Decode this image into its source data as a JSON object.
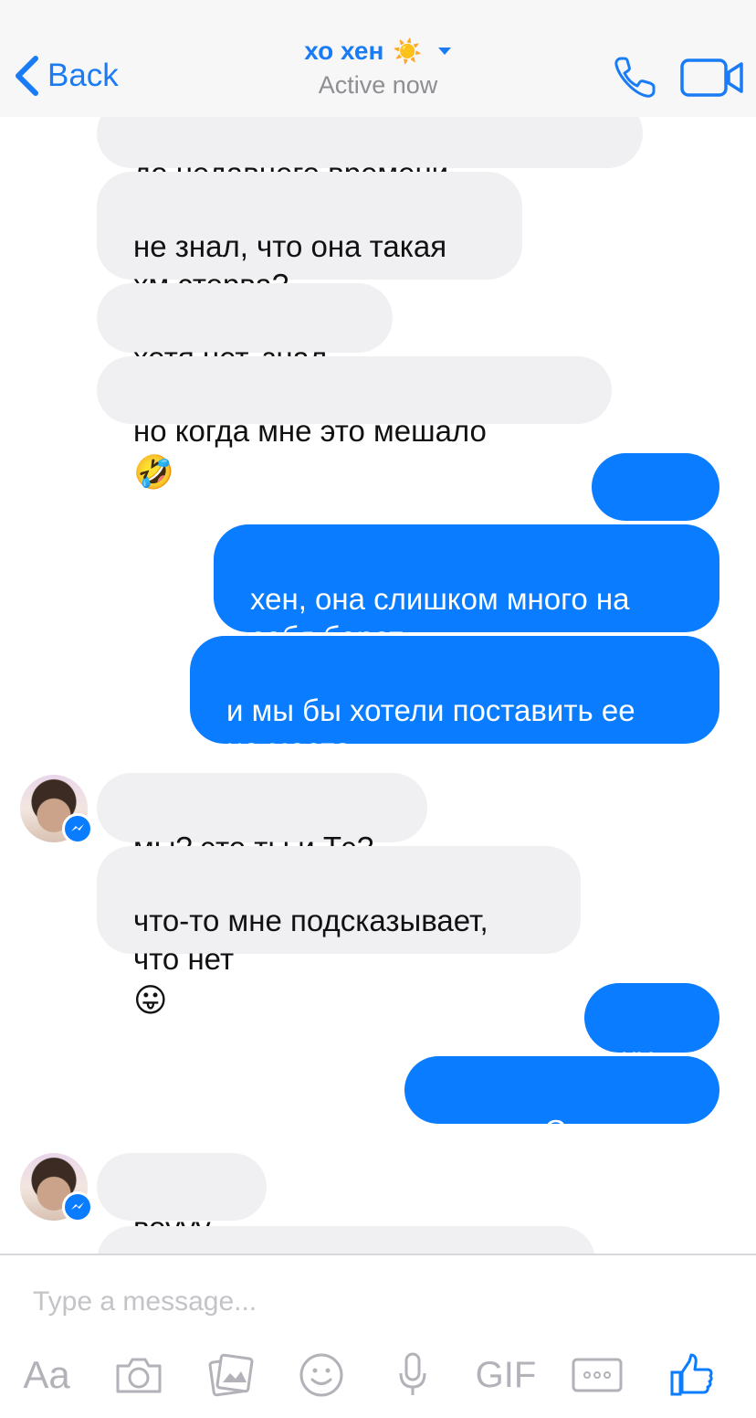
{
  "header": {
    "back_label": "Back",
    "contact_name": "хо хен",
    "name_emoji": "☀️",
    "status": "Active now"
  },
  "messages": [
    {
      "side": "in",
      "text": "до недавнего времени"
    },
    {
      "side": "in",
      "text": "не знал, что она такая\nхм стерва?"
    },
    {
      "side": "in",
      "text": "хотя нет, знал"
    },
    {
      "side": "in",
      "text": "но когда мне это мешало",
      "emoji": "🤣"
    },
    {
      "side": "out",
      "text": "......"
    },
    {
      "side": "out",
      "text": "хен, она слишком много на\nсебя берет"
    },
    {
      "side": "out",
      "text": "и мы бы хотели поставить ее\nна место"
    },
    {
      "side": "in",
      "text": "мы? это ты и Тэ?"
    },
    {
      "side": "in",
      "text": "что-то мне подсказывает,\nчто нет",
      "emoji": "😛"
    },
    {
      "side": "out",
      "text": "ну.."
    },
    {
      "side": "out",
      "text": "это я и Сольхен"
    },
    {
      "side": "in",
      "text": "воууу"
    }
  ],
  "composer": {
    "placeholder": "Type a message...",
    "aa_label": "Aa",
    "gif_label": "GIF"
  },
  "colors": {
    "accent": "#0a7cff",
    "incoming_bubble": "#f0f0f3",
    "header_bg": "#f7f7f8"
  },
  "icons": [
    "back-chevron-icon",
    "caret-down-icon",
    "phone-icon",
    "video-camera-icon",
    "camera-icon",
    "gallery-icon",
    "smiley-icon",
    "microphone-icon",
    "more-icon",
    "thumbs-up-icon",
    "messenger-badge-icon"
  ]
}
